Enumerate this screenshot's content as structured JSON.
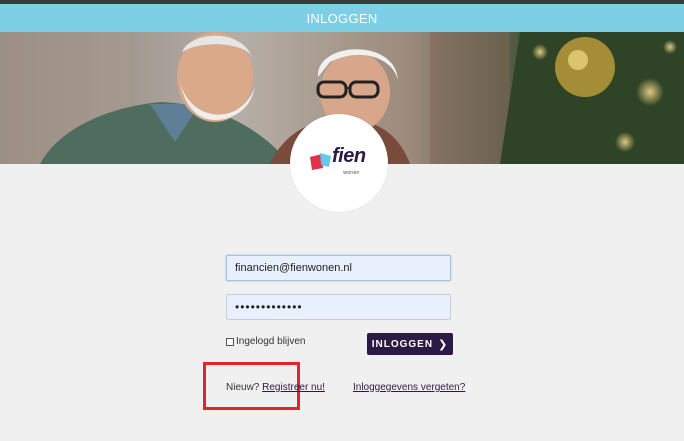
{
  "header": {
    "title": "INLOGGEN"
  },
  "logo": {
    "brand": "fien",
    "tagline": "wonen"
  },
  "form": {
    "email_value": "financien@fienwonen.nl",
    "password_value": "•••••••••••••",
    "remember_label": "Ingelogd blijven",
    "remember_checked": false,
    "submit_label": "INLOGGEN",
    "submit_icon": "chevron-right-icon"
  },
  "links": {
    "new_prefix": "Nieuw?",
    "register_label": "Registreer nu!",
    "forgot_label": "Inloggegevens vergeten?"
  },
  "colors": {
    "header_bg": "#7ccfe4",
    "button_bg": "#2d1a44",
    "highlight_box": "#e2252b"
  }
}
